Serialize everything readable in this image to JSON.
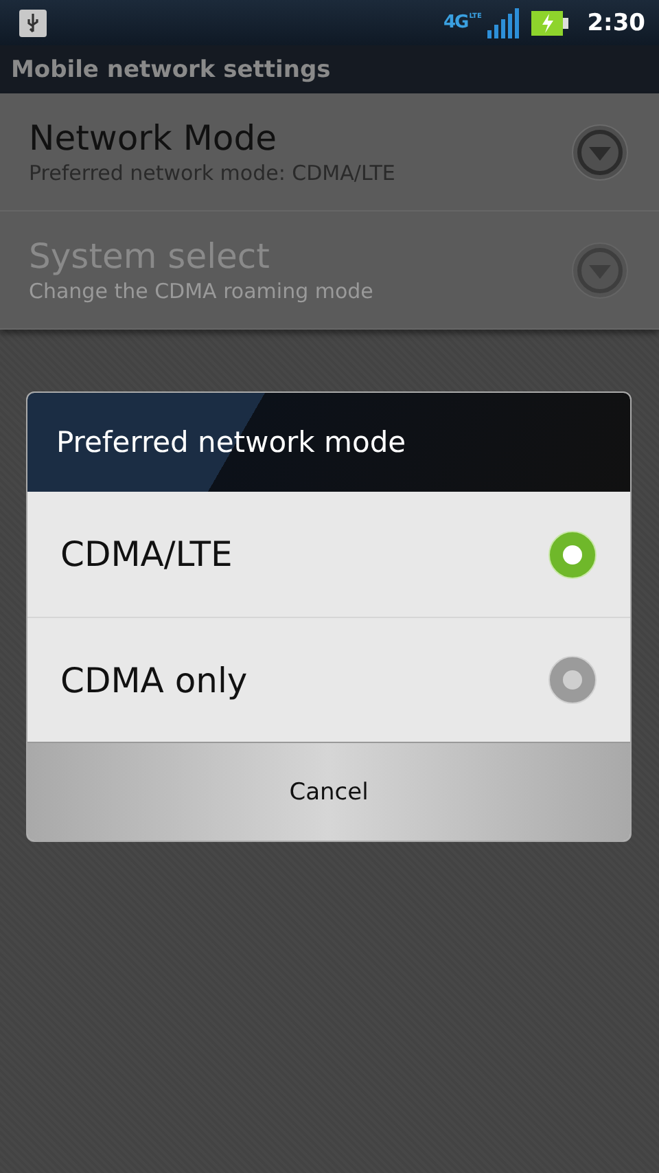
{
  "status_bar": {
    "network_type": "4G",
    "network_subtype": "LTE",
    "time": "2:30"
  },
  "title_bar": {
    "title": "Mobile network settings"
  },
  "settings": [
    {
      "title": "Network Mode",
      "summary": "Preferred network mode: CDMA/LTE",
      "disabled": false
    },
    {
      "title": "System select",
      "summary": "Change the CDMA roaming mode",
      "disabled": true
    }
  ],
  "dialog": {
    "title": "Preferred network mode",
    "options": [
      {
        "label": "CDMA/LTE",
        "selected": true
      },
      {
        "label": "CDMA only",
        "selected": false
      }
    ],
    "button": "Cancel"
  }
}
